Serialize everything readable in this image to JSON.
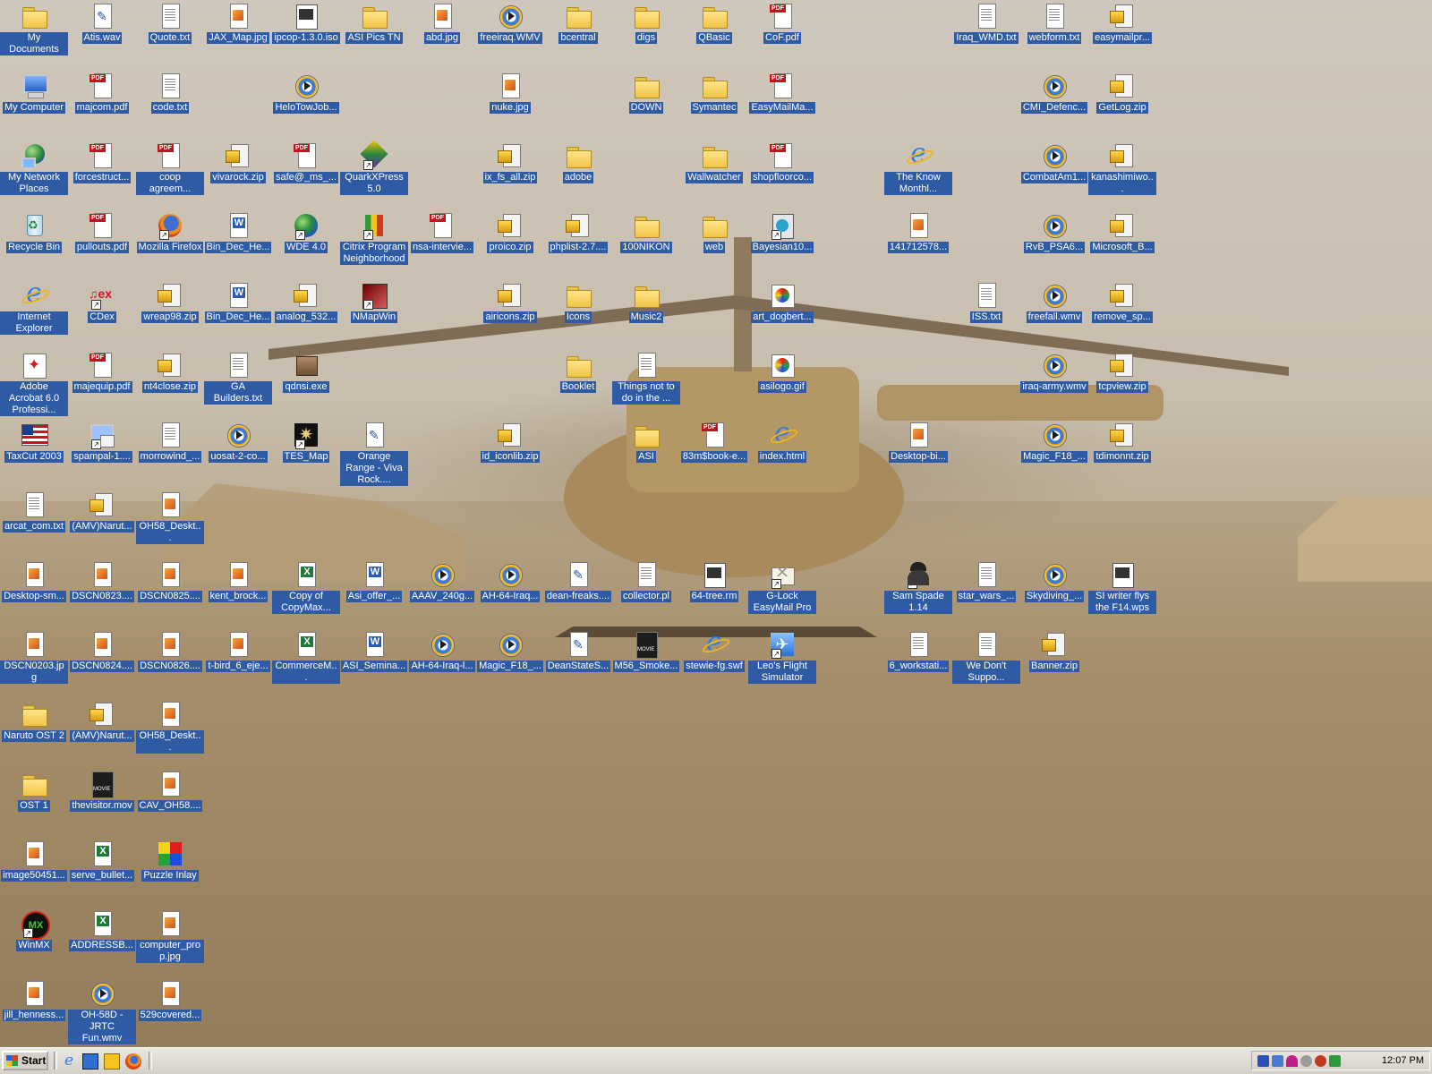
{
  "desktop": {
    "icons": [
      {
        "label": "My Documents",
        "type": "folder",
        "x": 0,
        "y": 0
      },
      {
        "label": "Atis.wav",
        "type": "wav",
        "x": 1,
        "y": 0
      },
      {
        "label": "Quote.txt",
        "type": "doc",
        "x": 2,
        "y": 0
      },
      {
        "label": "JAX_Map.jpg",
        "type": "img",
        "x": 3,
        "y": 0
      },
      {
        "label": "ipcop-1.3.0.iso",
        "type": "iso",
        "x": 4,
        "y": 0
      },
      {
        "label": "ASI Pics TN",
        "type": "folder",
        "x": 5,
        "y": 0
      },
      {
        "label": "abd.jpg",
        "type": "img",
        "x": 6,
        "y": 0
      },
      {
        "label": "freeiraq.WMV",
        "type": "media",
        "x": 7,
        "y": 0
      },
      {
        "label": "bcentral",
        "type": "folder",
        "x": 8,
        "y": 0
      },
      {
        "label": "digs",
        "type": "folder",
        "x": 9,
        "y": 0
      },
      {
        "label": "QBasic",
        "type": "folder",
        "x": 10,
        "y": 0
      },
      {
        "label": "CoF.pdf",
        "type": "pdf",
        "x": 11,
        "y": 0
      },
      {
        "label": "Iraq_WMD.txt",
        "type": "doc",
        "x": 14,
        "y": 0
      },
      {
        "label": "webform.txt",
        "type": "doc",
        "x": 15,
        "y": 0
      },
      {
        "label": "easymailpr...",
        "type": "zip",
        "x": 16,
        "y": 0
      },
      {
        "label": "My Computer",
        "type": "computer",
        "x": 0,
        "y": 1
      },
      {
        "label": "majcom.pdf",
        "type": "pdf",
        "x": 1,
        "y": 1
      },
      {
        "label": "code.txt",
        "type": "doc",
        "x": 2,
        "y": 1
      },
      {
        "label": "HeloTowJob...",
        "type": "media",
        "x": 4,
        "y": 1
      },
      {
        "label": "nuke.jpg",
        "type": "img",
        "x": 7,
        "y": 1
      },
      {
        "label": "DOWN",
        "type": "folder",
        "x": 9,
        "y": 1
      },
      {
        "label": "Symantec",
        "type": "folder",
        "x": 10,
        "y": 1
      },
      {
        "label": "EasyMailMa...",
        "type": "pdf",
        "x": 11,
        "y": 1
      },
      {
        "label": "CMI_Defenc...",
        "type": "media",
        "x": 15,
        "y": 1
      },
      {
        "label": "GetLog.zip",
        "type": "zip",
        "x": 16,
        "y": 1
      },
      {
        "label": "My Network Places",
        "type": "network",
        "x": 0,
        "y": 2
      },
      {
        "label": "forcestruct...",
        "type": "pdf",
        "x": 1,
        "y": 2
      },
      {
        "label": "coop agreem...",
        "type": "pdf",
        "x": 2,
        "y": 2
      },
      {
        "label": "vivarock.zip",
        "type": "zip",
        "x": 3,
        "y": 2
      },
      {
        "label": "safe@_ms_...",
        "type": "pdf",
        "x": 4,
        "y": 2
      },
      {
        "label": "QuarkXPress 5.0",
        "type": "quark",
        "x": 5,
        "y": 2,
        "shortcut": true
      },
      {
        "label": "ix_fs_all.zip",
        "type": "zip",
        "x": 7,
        "y": 2
      },
      {
        "label": "adobe",
        "type": "folder",
        "x": 8,
        "y": 2
      },
      {
        "label": "Wallwatcher",
        "type": "folder",
        "x": 10,
        "y": 2
      },
      {
        "label": "shopfloorco...",
        "type": "pdf",
        "x": 11,
        "y": 2
      },
      {
        "label": "The Know Monthl...",
        "type": "ie",
        "x": 13,
        "y": 2
      },
      {
        "label": "CombatAm1...",
        "type": "media",
        "x": 15,
        "y": 2
      },
      {
        "label": "kanashimiwo...",
        "type": "zip",
        "x": 16,
        "y": 2
      },
      {
        "label": "Recycle Bin",
        "type": "recycle",
        "x": 0,
        "y": 3
      },
      {
        "label": "pullouts.pdf",
        "type": "pdf",
        "x": 1,
        "y": 3
      },
      {
        "label": "Mozilla Firefox",
        "type": "firefox",
        "x": 2,
        "y": 3,
        "shortcut": true
      },
      {
        "label": "Bin_Dec_He...",
        "type": "word",
        "x": 3,
        "y": 3
      },
      {
        "label": "WDE 4.0",
        "type": "globe",
        "x": 4,
        "y": 3,
        "shortcut": true
      },
      {
        "label": "Citrix Program Neighborhood",
        "type": "citrix",
        "x": 5,
        "y": 3,
        "shortcut": true
      },
      {
        "label": "nsa-intervie...",
        "type": "pdf",
        "x": 6,
        "y": 3
      },
      {
        "label": "proico.zip",
        "type": "zip",
        "x": 7,
        "y": 3
      },
      {
        "label": "phplist-2.7....",
        "type": "zip",
        "x": 8,
        "y": 3
      },
      {
        "label": "100NIKON",
        "type": "folder",
        "x": 9,
        "y": 3
      },
      {
        "label": "web",
        "type": "folder",
        "x": 10,
        "y": 3
      },
      {
        "label": "Bayesian10...",
        "type": "bayes",
        "x": 11,
        "y": 3,
        "shortcut": true
      },
      {
        "label": "141712578...",
        "type": "img",
        "x": 13,
        "y": 3
      },
      {
        "label": "RvB_PSA6...",
        "type": "media",
        "x": 15,
        "y": 3
      },
      {
        "label": "Microsoft_B...",
        "type": "zip",
        "x": 16,
        "y": 3
      },
      {
        "label": "Internet Explorer",
        "type": "ie",
        "x": 0,
        "y": 4
      },
      {
        "label": "CDex",
        "type": "cdex",
        "x": 1,
        "y": 4,
        "shortcut": true
      },
      {
        "label": "wreap98.zip",
        "type": "zip",
        "x": 2,
        "y": 4
      },
      {
        "label": "Bin_Dec_He...",
        "type": "word",
        "x": 3,
        "y": 4
      },
      {
        "label": "analog_532...",
        "type": "zip",
        "x": 4,
        "y": 4
      },
      {
        "label": "NMapWin",
        "type": "dark",
        "x": 5,
        "y": 4,
        "shortcut": true
      },
      {
        "label": "airicons.zip",
        "type": "zip",
        "x": 7,
        "y": 4
      },
      {
        "label": "Icons",
        "type": "folder",
        "x": 8,
        "y": 4
      },
      {
        "label": "Music2",
        "type": "folder",
        "x": 9,
        "y": 4
      },
      {
        "label": "art_dogbert...",
        "type": "paint",
        "x": 11,
        "y": 4
      },
      {
        "label": "ISS.txt",
        "type": "doc",
        "x": 14,
        "y": 4
      },
      {
        "label": "freefall.wmv",
        "type": "media",
        "x": 15,
        "y": 4
      },
      {
        "label": "remove_sp...",
        "type": "zip",
        "x": 16,
        "y": 4
      },
      {
        "label": "Adobe Acrobat 6.0 Professi...",
        "type": "acrobat",
        "x": 0,
        "y": 5
      },
      {
        "label": "majequip.pdf",
        "type": "pdf",
        "x": 1,
        "y": 5
      },
      {
        "label": "nt4close.zip",
        "type": "zip",
        "x": 2,
        "y": 5
      },
      {
        "label": "GA Builders.txt",
        "type": "doc",
        "x": 3,
        "y": 5
      },
      {
        "label": "qdnsi.exe",
        "type": "box",
        "x": 4,
        "y": 5
      },
      {
        "label": "Booklet",
        "type": "folder",
        "x": 8,
        "y": 5
      },
      {
        "label": "Things not to do in the ...",
        "type": "doc",
        "x": 9,
        "y": 5
      },
      {
        "label": "asilogo.gif",
        "type": "paint",
        "x": 11,
        "y": 5
      },
      {
        "label": "iraq-army.wmv",
        "type": "media",
        "x": 15,
        "y": 5
      },
      {
        "label": "tcpview.zip",
        "type": "zip",
        "x": 16,
        "y": 5
      },
      {
        "label": "TaxCut 2003",
        "type": "flag",
        "x": 0,
        "y": 6
      },
      {
        "label": "spampal-1....",
        "type": "spampal",
        "x": 1,
        "y": 6,
        "shortcut": true
      },
      {
        "label": "morrowind_...",
        "type": "doc",
        "x": 2,
        "y": 6
      },
      {
        "label": "uosat-2-co...",
        "type": "media",
        "x": 3,
        "y": 6
      },
      {
        "label": "TES_Map",
        "type": "tes",
        "x": 4,
        "y": 6,
        "shortcut": true
      },
      {
        "label": "Orange Range - Viva Rock....",
        "type": "wav",
        "x": 5,
        "y": 6
      },
      {
        "label": "id_iconlib.zip",
        "type": "zip",
        "x": 7,
        "y": 6
      },
      {
        "label": "ASI",
        "type": "folder",
        "x": 9,
        "y": 6
      },
      {
        "label": "83m$book-e...",
        "type": "pdf",
        "x": 10,
        "y": 6
      },
      {
        "label": "index.html",
        "type": "ie",
        "x": 11,
        "y": 6
      },
      {
        "label": "Desktop-bi...",
        "type": "img",
        "x": 13,
        "y": 6
      },
      {
        "label": "Magic_F18_...",
        "type": "media",
        "x": 15,
        "y": 6
      },
      {
        "label": "tdimonnt.zip",
        "type": "zip",
        "x": 16,
        "y": 6
      },
      {
        "label": "arcat_com.txt",
        "type": "doc",
        "x": 0,
        "y": 7
      },
      {
        "label": "(AMV)Narut...",
        "type": "zip",
        "x": 1,
        "y": 7
      },
      {
        "label": "OH58_Deskt...",
        "type": "img",
        "x": 2,
        "y": 7
      },
      {
        "label": "Desktop-sm...",
        "type": "img",
        "x": 0,
        "y": 8
      },
      {
        "label": "DSCN0823....",
        "type": "img",
        "x": 1,
        "y": 8
      },
      {
        "label": "DSCN0825....",
        "type": "img",
        "x": 2,
        "y": 8
      },
      {
        "label": "kent_brock...",
        "type": "img",
        "x": 3,
        "y": 8
      },
      {
        "label": "Copy of CopyMax...",
        "type": "excel",
        "x": 4,
        "y": 8
      },
      {
        "label": "Asi_offer_...",
        "type": "word",
        "x": 5,
        "y": 8
      },
      {
        "label": "AAAV_240g...",
        "type": "media",
        "x": 6,
        "y": 8
      },
      {
        "label": "AH-64-Iraq...",
        "type": "media",
        "x": 7,
        "y": 8
      },
      {
        "label": "dean-freaks....",
        "type": "wav",
        "x": 8,
        "y": 8
      },
      {
        "label": "collector.pl",
        "type": "doc",
        "x": 9,
        "y": 8
      },
      {
        "label": "64-tree.rm",
        "type": "iso",
        "x": 10,
        "y": 8
      },
      {
        "label": "G-Lock EasyMail Pro",
        "type": "glock",
        "x": 11,
        "y": 8,
        "shortcut": true
      },
      {
        "label": "Sam Spade 1.14",
        "type": "spy",
        "x": 13,
        "y": 8,
        "shortcut": true
      },
      {
        "label": "star_wars_...",
        "type": "doc",
        "x": 14,
        "y": 8
      },
      {
        "label": "Skydiving_...",
        "type": "media",
        "x": 15,
        "y": 8
      },
      {
        "label": "SI writer flys the F14.wps",
        "type": "iso",
        "x": 16,
        "y": 8
      },
      {
        "label": "DSCN0203.jpg",
        "type": "img",
        "x": 0,
        "y": 9
      },
      {
        "label": "DSCN0824....",
        "type": "img",
        "x": 1,
        "y": 9
      },
      {
        "label": "DSCN0826....",
        "type": "img",
        "x": 2,
        "y": 9
      },
      {
        "label": "t-bird_6_eje...",
        "type": "img",
        "x": 3,
        "y": 9
      },
      {
        "label": "CommerceM...",
        "type": "excel",
        "x": 4,
        "y": 9
      },
      {
        "label": "ASI_Semina...",
        "type": "word",
        "x": 5,
        "y": 9
      },
      {
        "label": "AH-64-Iraq-l...",
        "type": "media",
        "x": 6,
        "y": 9
      },
      {
        "label": "Magic_F18_...",
        "type": "media",
        "x": 7,
        "y": 9
      },
      {
        "label": "DeanStateS...",
        "type": "wav",
        "x": 8,
        "y": 9
      },
      {
        "label": "M56_Smoke...",
        "type": "movie",
        "x": 9,
        "y": 9
      },
      {
        "label": "stewie-fg.swf",
        "type": "ie",
        "x": 10,
        "y": 9
      },
      {
        "label": "Leo's Flight Simulator",
        "type": "flight",
        "x": 11,
        "y": 9,
        "shortcut": true
      },
      {
        "label": "6_workstati...",
        "type": "doc",
        "x": 13,
        "y": 9
      },
      {
        "label": "We Don't Suppo...",
        "type": "doc",
        "x": 14,
        "y": 9
      },
      {
        "label": "Banner.zip",
        "type": "zip",
        "x": 15,
        "y": 9
      },
      {
        "label": "Naruto OST 2",
        "type": "folder",
        "x": 0,
        "y": 10
      },
      {
        "label": "(AMV)Narut...",
        "type": "zip",
        "x": 1,
        "y": 10
      },
      {
        "label": "OH58_Deskt...",
        "type": "img",
        "x": 2,
        "y": 10
      },
      {
        "label": "OST 1",
        "type": "folder",
        "x": 0,
        "y": 11
      },
      {
        "label": "thevisitor.mov",
        "type": "movie",
        "x": 1,
        "y": 11
      },
      {
        "label": "CAV_OH58....",
        "type": "img",
        "x": 2,
        "y": 11
      },
      {
        "label": "image50451...",
        "type": "img",
        "x": 0,
        "y": 12
      },
      {
        "label": "serve_bullet...",
        "type": "excel",
        "x": 1,
        "y": 12
      },
      {
        "label": "Puzzle Inlay",
        "type": "puzzle",
        "x": 2,
        "y": 12
      },
      {
        "label": "WinMX",
        "type": "winmx",
        "x": 0,
        "y": 13,
        "shortcut": true
      },
      {
        "label": "ADDRESSB...",
        "type": "excel",
        "x": 1,
        "y": 13
      },
      {
        "label": "computer_pro p.jpg",
        "type": "img",
        "x": 2,
        "y": 13
      },
      {
        "label": "jill_henness...",
        "type": "img",
        "x": 0,
        "y": 14
      },
      {
        "label": "OH-58D - JRTC Fun.wmv",
        "type": "media",
        "x": 1,
        "y": 14
      },
      {
        "label": "529covered...",
        "type": "img",
        "x": 2,
        "y": 14
      }
    ]
  },
  "taskbar": {
    "start_label": "Start",
    "quick_launch": [
      "ie-icon",
      "show-desktop-icon",
      "outlook-icon",
      "firefox-icon"
    ],
    "tray_icons": [
      "volume-icon",
      "network-icon",
      "umbrella-icon",
      "shield-icon",
      "app-icon",
      "security-icon"
    ],
    "clock": "12:07 PM"
  }
}
